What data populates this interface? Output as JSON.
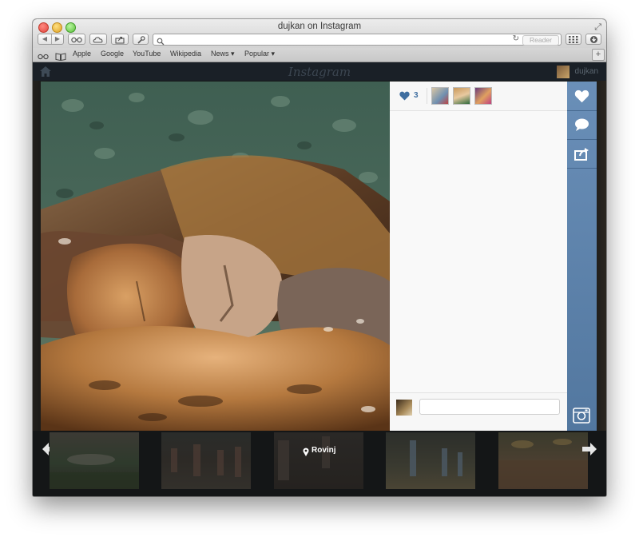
{
  "window": {
    "title": "dujkan on Instagram"
  },
  "toolbar": {
    "reader_label": "Reader",
    "url_value": ""
  },
  "bookmarks": [
    "Apple",
    "Google",
    "YouTube",
    "Wikipedia",
    "News ▾",
    "Popular ▾"
  ],
  "header": {
    "logo": "Instagram",
    "username": "dujkan"
  },
  "post": {
    "like_count": "3",
    "location": "Rovinj",
    "comment_placeholder": ""
  },
  "colors": {
    "action_bar": "#5a80aa",
    "like_blue": "#3f6ea0",
    "panel_bg": "#f7f7f7"
  }
}
